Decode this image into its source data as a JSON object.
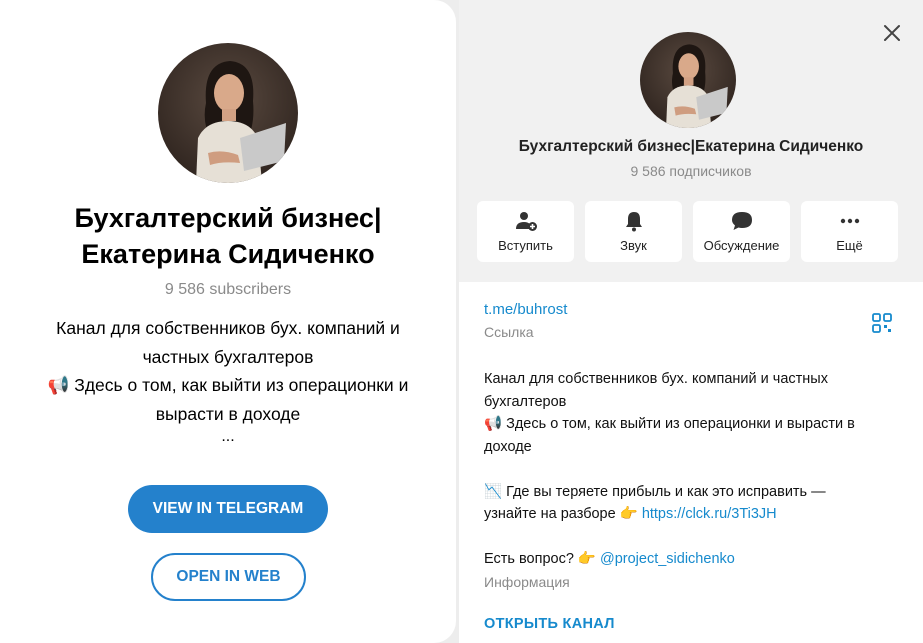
{
  "web_preview": {
    "title_line1": "Бухгалтерский бизнес|",
    "title_line2": "Екатерина Сидиченко",
    "subscribers": "9 586 subscribers",
    "desc_line1": "Канал для собственников бух. компаний и",
    "desc_line2": "частных бухгалтеров",
    "desc_line3": "📢 Здесь о том, как выйти из операционки и",
    "desc_line4": "вырасти в доходе",
    "ellipsis": "...",
    "view_button": "VIEW IN TELEGRAM",
    "web_button": "OPEN IN WEB"
  },
  "channel_info": {
    "name": "Бухгалтерский бизнес|Екатерина Сидиченко",
    "subscribers": "9 586 подписчиков",
    "actions": [
      {
        "label": "Вступить",
        "icon": "add-user-icon"
      },
      {
        "label": "Звук",
        "icon": "bell-icon"
      },
      {
        "label": "Обсуждение",
        "icon": "chat-bubble-icon"
      },
      {
        "label": "Ещё",
        "icon": "more-dots-icon"
      }
    ],
    "link": "t.me/buhrost",
    "link_caption": "Ссылка",
    "desc_line1": "Канал для собственников бух. компаний  и частных",
    "desc_line2": "бухгалтеров",
    "desc_line3": "📢 Здесь о том, как выйти из операционки и вырасти в",
    "desc_line4": "доходе",
    "desc_line5": "📉 Где вы теряете прибыль и как это исправить —",
    "desc_line6_text": "узнайте на разборе 👉 ",
    "desc_line6_link": "https://clck.ru/3Ti3JH",
    "desc_line7_text": "Есть вопрос? 👉 ",
    "desc_line7_link": "@project_sidichenko",
    "info_caption": "Информация",
    "open_channel": "ОТКРЫТЬ КАНАЛ"
  },
  "colors": {
    "accent": "#2481cc",
    "link": "#168acd",
    "header_bg": "#f1f1f1"
  }
}
